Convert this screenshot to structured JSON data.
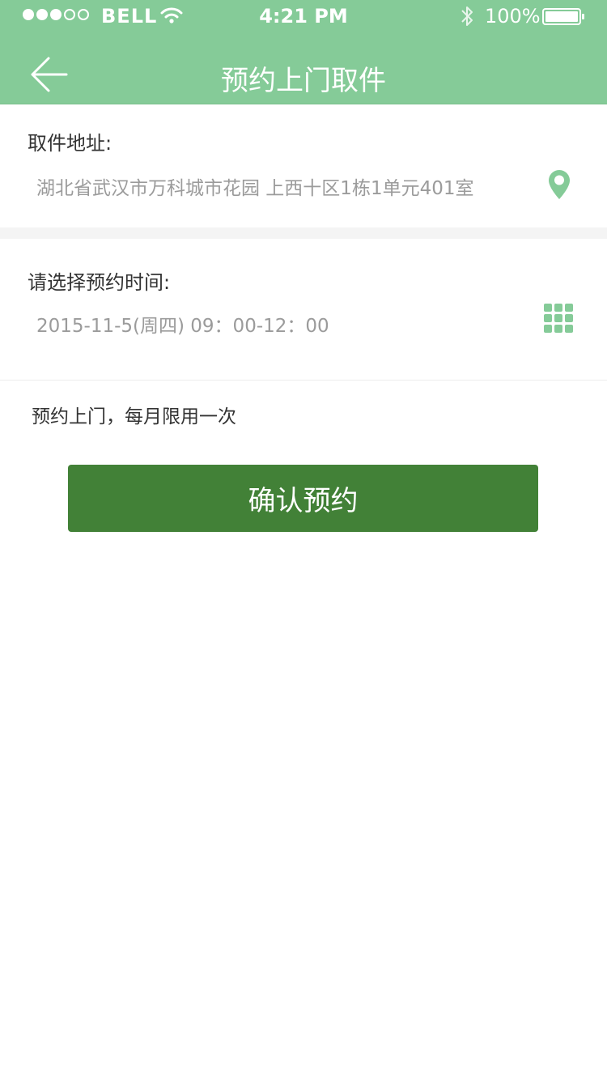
{
  "status_bar": {
    "carrier": "BELL",
    "time": "4:21 PM",
    "battery": "100%",
    "signal_full": 3,
    "signal_empty": 2
  },
  "header": {
    "title": "预约上门取件",
    "back_icon": "arrow-left-icon",
    "background_color": "#85cb98"
  },
  "address": {
    "label": "取件地址:",
    "value": "湖北省武汉市万科城市花园  上西十区1栋1单元401室",
    "icon": "location-pin-icon"
  },
  "appointment_time": {
    "label": "请选择预约时间:",
    "value": "2015-11-5(周四)  09：00-12：00",
    "icon": "calendar-grid-icon"
  },
  "note": "预约上门，每月限用一次",
  "confirm_button": {
    "label": "确认预约",
    "color": "#428137"
  },
  "accent_color": "#85cb98"
}
